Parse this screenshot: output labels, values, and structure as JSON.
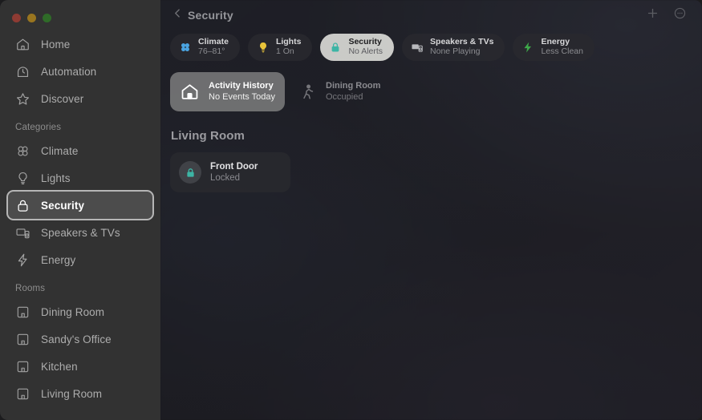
{
  "window": {
    "traffic_lights": [
      "close",
      "minimize",
      "zoom"
    ]
  },
  "sidebar": {
    "top_items": [
      {
        "label": "Home",
        "icon": "home-icon"
      },
      {
        "label": "Automation",
        "icon": "automation-clock-icon"
      },
      {
        "label": "Discover",
        "icon": "star-icon"
      }
    ],
    "categories_label": "Categories",
    "categories": [
      {
        "label": "Climate",
        "icon": "fan-icon",
        "selected": false
      },
      {
        "label": "Lights",
        "icon": "bulb-icon",
        "selected": false
      },
      {
        "label": "Security",
        "icon": "lock-icon",
        "selected": true
      },
      {
        "label": "Speakers & TVs",
        "icon": "tv-speaker-icon",
        "selected": false
      },
      {
        "label": "Energy",
        "icon": "bolt-icon",
        "selected": false
      }
    ],
    "rooms_label": "Rooms",
    "rooms": [
      {
        "label": "Dining Room",
        "icon": "room-icon"
      },
      {
        "label": "Sandy's Office",
        "icon": "room-icon"
      },
      {
        "label": "Kitchen",
        "icon": "room-icon"
      },
      {
        "label": "Living Room",
        "icon": "room-icon"
      }
    ]
  },
  "toolbar": {
    "back_icon": "chevron-left-icon",
    "title": "Security",
    "add_label": "add-icon",
    "more_label": "more-circle-icon"
  },
  "status_pills": [
    {
      "title": "Climate",
      "subtitle": "76–81°",
      "icon": "fan-icon",
      "color": "#4aa3e0",
      "active": false
    },
    {
      "title": "Lights",
      "subtitle": "1 On",
      "icon": "bulb-icon",
      "color": "#e8c33a",
      "active": false
    },
    {
      "title": "Security",
      "subtitle": "No Alerts",
      "icon": "lock-icon",
      "color": "#3db5a5",
      "active": true
    },
    {
      "title": "Speakers & TVs",
      "subtitle": "None Playing",
      "icon": "tv-speaker-icon",
      "color": "#b8b9bd",
      "active": false
    },
    {
      "title": "Speakers & TVs",
      "subtitle": "None Playing",
      "icon": "tv-speaker-icon",
      "color": "#b8b9bd",
      "active": false,
      "hidden": true
    },
    {
      "title": "Energy",
      "subtitle": "Less Clean",
      "icon": "bolt-icon",
      "color": "#3ea94a",
      "active": false
    }
  ],
  "activity": {
    "title": "Activity History",
    "subtitle": "No Events Today",
    "icon": "home-filled-icon"
  },
  "motion": {
    "title": "Dining Room",
    "subtitle": "Occupied",
    "icon": "walking-person-icon"
  },
  "room_section": {
    "heading": "Living Room",
    "tiles": [
      {
        "title": "Front Door",
        "subtitle": "Locked",
        "icon": "lock-icon",
        "color": "#3db5a5"
      }
    ]
  },
  "colors": {
    "sidebar_bg": "#323232",
    "selected_row_bg": "#4c4c4c",
    "focus_ring": "#b6b6b6",
    "accent_teal": "#3db5a5",
    "accent_blue": "#4aa3e0",
    "accent_yellow": "#e8c33a",
    "accent_green": "#3ea94a"
  }
}
